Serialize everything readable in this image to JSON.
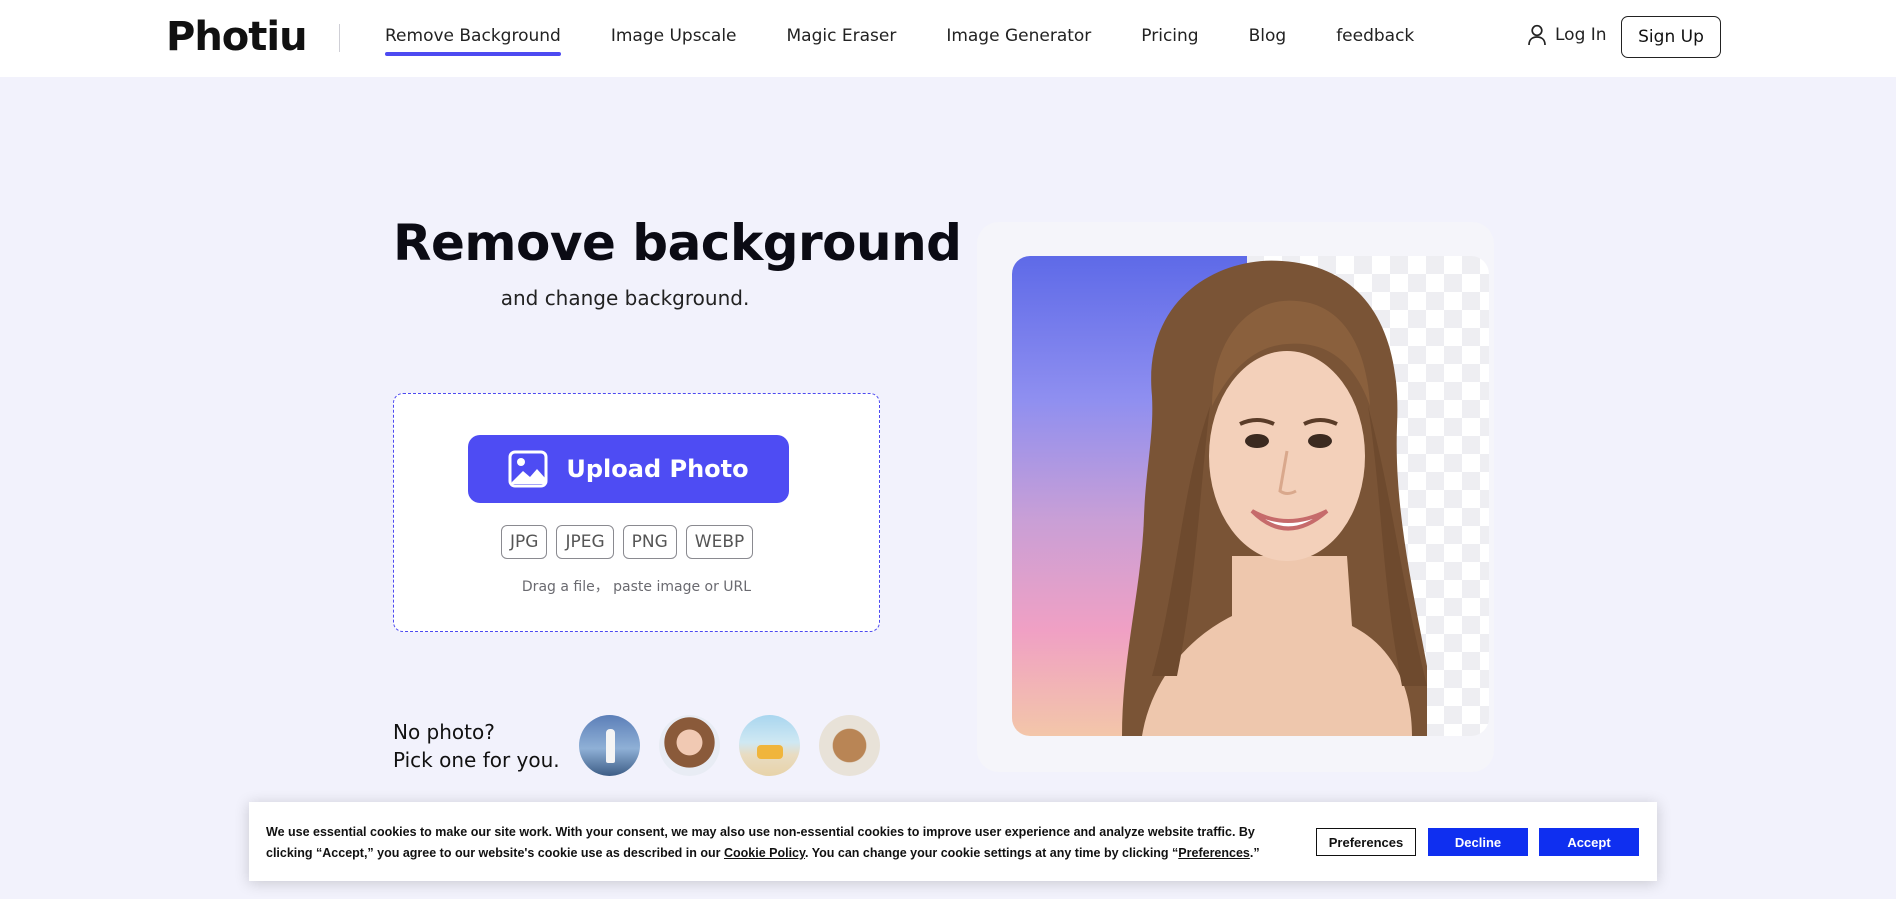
{
  "header": {
    "logo": "Photiu",
    "nav": [
      {
        "label": "Remove Background",
        "active": true
      },
      {
        "label": "Image Upscale"
      },
      {
        "label": "Magic Eraser"
      },
      {
        "label": "Image Generator"
      },
      {
        "label": "Pricing"
      },
      {
        "label": "Blog"
      },
      {
        "label": "feedback"
      }
    ],
    "login_label": "Log In",
    "signup_label": "Sign Up",
    "user_icon": "user-icon"
  },
  "hero": {
    "title": "Remove background",
    "subtitle": "and change background."
  },
  "upload": {
    "button_label": "Upload Photo",
    "button_icon": "image-icon",
    "formats": [
      "JPG",
      "JPEG",
      "PNG",
      "WEBP"
    ],
    "hint": "Drag a file， paste image or URL"
  },
  "samples": {
    "prompt_line1": "No photo?",
    "prompt_line2": "Pick one for you."
  },
  "cookie": {
    "text_part1": "We use essential cookies to make our site work. With your consent, we may also use non-essential cookies to improve user experience and analyze website traffic. By clicking “Accept,” you agree to our website's cookie use as described in our ",
    "link_policy": "Cookie Policy",
    "text_part2": ". You can change your cookie settings at any time by clicking “",
    "link_preferences": "Preferences",
    "text_part3": ".”",
    "preferences_label": "Preferences",
    "decline_label": "Decline",
    "accept_label": "Accept"
  },
  "colors": {
    "accent": "#4e4cf3",
    "cookie_button": "#0f2ff0",
    "page_bg": "#f2f2fc"
  }
}
